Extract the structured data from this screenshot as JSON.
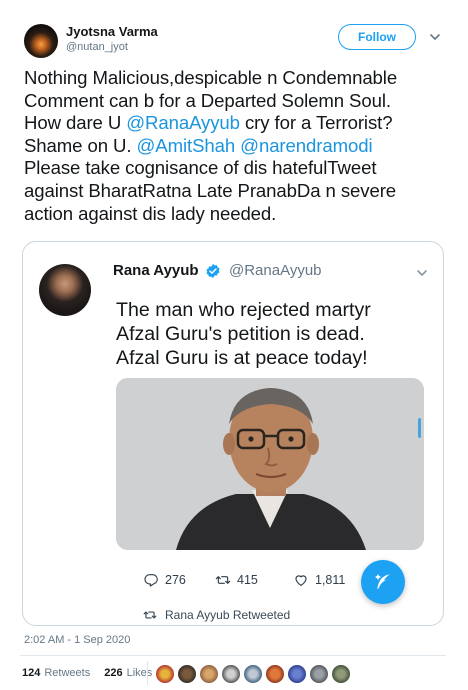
{
  "author": {
    "name": "Jyotsna Varma",
    "handle": "@nutan_jyot",
    "follow_label": "Follow",
    "avatar_icon": "candle-avatar"
  },
  "tweet": {
    "lines": [
      [
        {
          "t": "Nothing Malicious,despicable n Condemnable"
        }
      ],
      [
        {
          "t": "Comment can b for a Departed Solemn Soul."
        }
      ],
      [
        {
          "t": "How dare U "
        },
        {
          "t": "@RanaAyyub",
          "mention": true
        },
        {
          "t": " cry for a Terrorist?"
        }
      ],
      [
        {
          "t": "Shame on U. "
        },
        {
          "t": "@AmitShah",
          "mention": true
        },
        {
          "t": " "
        },
        {
          "t": "@narendramodi",
          "mention": true
        }
      ],
      [
        {
          "t": "Please take cognisance of dis hatefulTweet"
        }
      ],
      [
        {
          "t": "against BharatRatna Late PranabDa n severe"
        }
      ],
      [
        {
          "t": "action against dis lady needed."
        }
      ]
    ],
    "mention_color": "#1b95e0"
  },
  "quoted": {
    "name": "Rana Ayyub",
    "verified_icon": "verified-badge-icon",
    "handle": "@RanaAyyub",
    "text_lines": [
      "The man who rejected martyr",
      "Afzal Guru's petition is dead.",
      "Afzal Guru is at peace today!"
    ],
    "replies": "276",
    "retweets": "415",
    "likes": "1,811",
    "retweeted_by": "Rana Ayyub Retweeted"
  },
  "meta": {
    "timestamp": "2:02 AM - 1 Sep 2020",
    "retweets_count": "124",
    "retweets_label": "Retweets",
    "likes_count": "226",
    "likes_label": "Likes"
  },
  "colors": {
    "accent": "#1da1f2",
    "secondary_text": "#657786",
    "border": "#ccd6dd"
  }
}
